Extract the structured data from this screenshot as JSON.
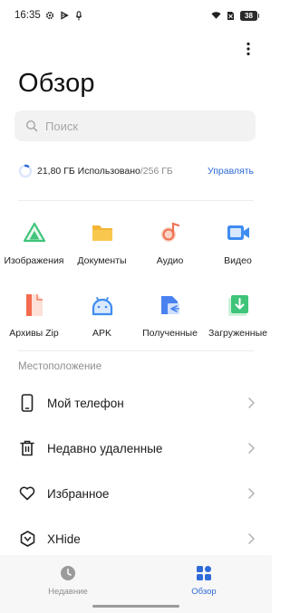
{
  "status_bar": {
    "time": "16:35",
    "battery": "38"
  },
  "header": {
    "title": "Обзор"
  },
  "search": {
    "placeholder": "Поиск"
  },
  "storage": {
    "used_text": "21,80 ГБ Использовано",
    "total_text": "/256 ГБ",
    "used_fraction": 0.085,
    "manage_label": "Управлять"
  },
  "categories": [
    {
      "label": "Изображения",
      "icon": "images-icon"
    },
    {
      "label": "Документы",
      "icon": "documents-icon"
    },
    {
      "label": "Аудио",
      "icon": "audio-icon"
    },
    {
      "label": "Видео",
      "icon": "video-icon"
    },
    {
      "label": "Архивы Zip",
      "icon": "zip-archive-icon"
    },
    {
      "label": "APK",
      "icon": "apk-android-icon"
    },
    {
      "label": "Полученные",
      "icon": "received-icon"
    },
    {
      "label": "Загруженные",
      "icon": "downloaded-icon"
    }
  ],
  "locations": {
    "section_title": "Местоположение",
    "items": [
      {
        "label": "Мой телефон",
        "icon": "phone-icon"
      },
      {
        "label": "Недавно удаленные",
        "icon": "trash-icon"
      },
      {
        "label": "Избранное",
        "icon": "heart-icon"
      },
      {
        "label": "XHide",
        "icon": "xhide-hexagon-icon"
      }
    ]
  },
  "bottom_nav": {
    "tabs": [
      {
        "label": "Недавние",
        "icon": "clock-icon",
        "active": false
      },
      {
        "label": "Обзор",
        "icon": "grid-icon",
        "active": true
      }
    ]
  },
  "colors": {
    "accent": "#2e6ad9",
    "images": "#3fc47a",
    "documents": "#f2b535",
    "audio": "#ee7252",
    "video": "#3f8cf0",
    "zip": "#f46a4e",
    "apk": "#3f8cf0",
    "received": "#4a82f0",
    "downloaded": "#3fc47a"
  }
}
